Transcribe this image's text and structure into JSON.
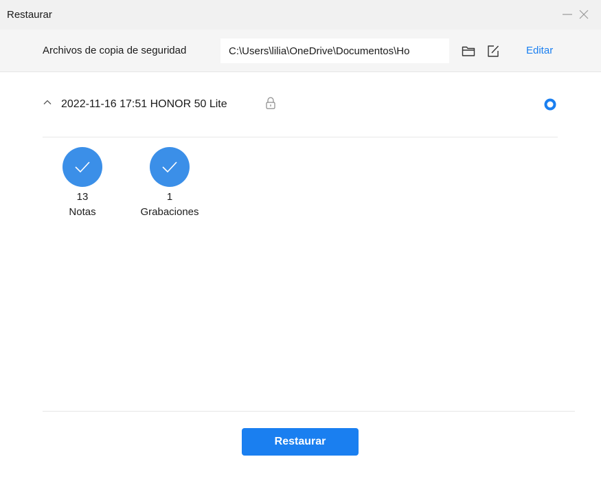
{
  "window": {
    "title": "Restaurar"
  },
  "path_bar": {
    "label": "Archivos de copia de seguridad",
    "path_value": "C:\\Users\\lilia\\OneDrive\\Documentos\\Ho",
    "edit_link": "Editar"
  },
  "backup": {
    "label": "2022-11-16 17:51 HONOR 50 Lite",
    "selected": true,
    "expanded": true,
    "items": [
      {
        "count": "13",
        "name": "Notas",
        "checked": true
      },
      {
        "count": "1",
        "name": "Grabaciones",
        "checked": true
      }
    ]
  },
  "footer": {
    "restore_label": "Restaurar"
  },
  "icons": {
    "minimize": "minimize-icon",
    "close": "close-icon",
    "folder": "folder-icon",
    "edit": "edit-icon",
    "chevron": "chevron-up-icon",
    "lock": "lock-icon",
    "radio": "radio-selected-icon",
    "check": "checkmark-icon"
  },
  "colors": {
    "accent": "#1a7ff0",
    "item_circle": "#3b8fe8",
    "titlebar_bg": "#f1f1f1",
    "pathbar_bg": "#f5f5f5"
  }
}
